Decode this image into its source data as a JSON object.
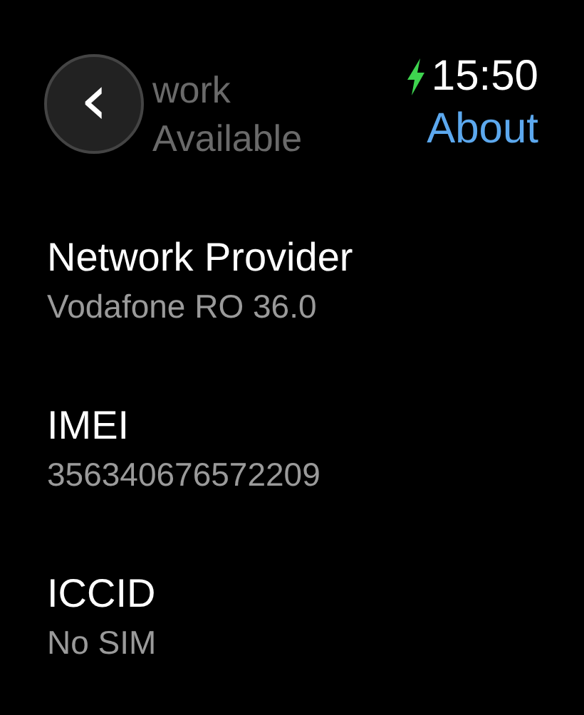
{
  "header": {
    "back_button": "‹",
    "faded_title": [
      "work",
      "Available"
    ],
    "charging": true,
    "time": "15:50",
    "title": "About"
  },
  "items": [
    {
      "label": "Network Provider",
      "value": "Vodafone RO 36.0"
    },
    {
      "label": "IMEI",
      "value": "356340676572209"
    },
    {
      "label": "ICCID",
      "value": "No SIM"
    }
  ]
}
